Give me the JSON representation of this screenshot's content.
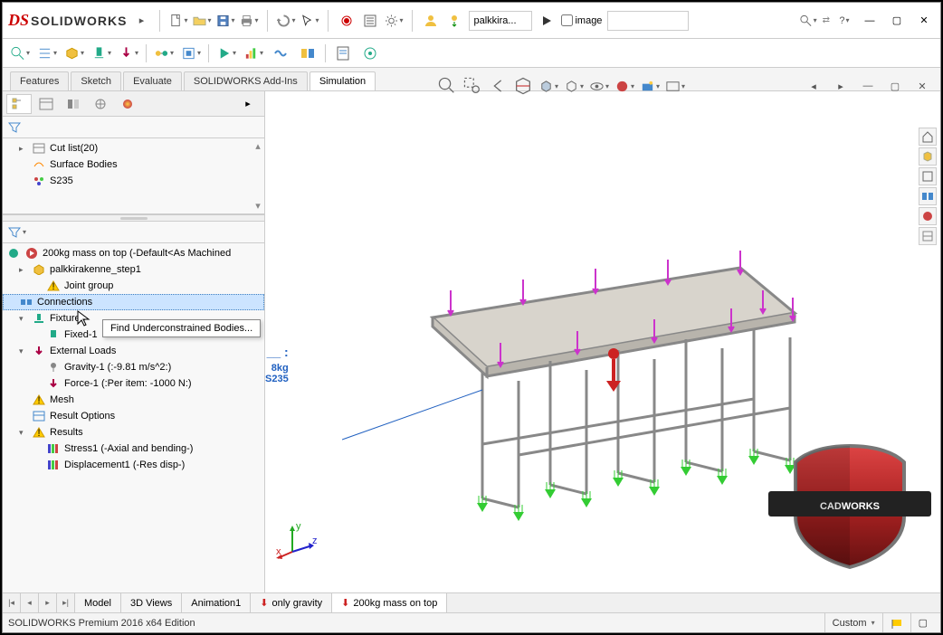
{
  "app": {
    "name": "SOLIDWORKS"
  },
  "titlebar": {
    "user_input": "palkkira...",
    "image_checkbox_label": "image"
  },
  "command_tabs": {
    "items": [
      "Features",
      "Sketch",
      "Evaluate",
      "SOLIDWORKS Add-Ins",
      "Simulation"
    ],
    "active": 4
  },
  "feature_tree_top": {
    "cut_list": "Cut list(20)",
    "surface_bodies": "Surface Bodies",
    "material": "S235"
  },
  "sim_tree": {
    "study": "200kg mass on top (-Default<As Machined",
    "part": "palkkirakenne_step1",
    "joint_group": "Joint group",
    "connections": "Connections",
    "fixtures": "Fixtures",
    "fixed": "Fixed-1",
    "external_loads": "External Loads",
    "gravity": "Gravity-1 (:-9.81 m/s^2:)",
    "force": "Force-1 (:Per item: -1000 N:)",
    "mesh": "Mesh",
    "result_options": "Result Options",
    "results": "Results",
    "stress": "Stress1 (-Axial and bending-)",
    "displacement": "Displacement1 (-Res disp-)"
  },
  "tooltip": {
    "text": "Find Underconstrained Bodies..."
  },
  "annotation": {
    "line2": "8kg",
    "material": "S235"
  },
  "bottom_tabs": {
    "items": [
      "Model",
      "3D Views",
      "Animation1",
      "only gravity",
      "200kg mass on top"
    ],
    "active": 4
  },
  "statusbar": {
    "edition": "SOLIDWORKS Premium 2016 x64 Edition",
    "view": "Custom"
  },
  "badge": {
    "brand": "CADWORKS"
  },
  "colors": {
    "accent": "#c00",
    "select": "#cce4ff",
    "link": "#2060c0"
  }
}
